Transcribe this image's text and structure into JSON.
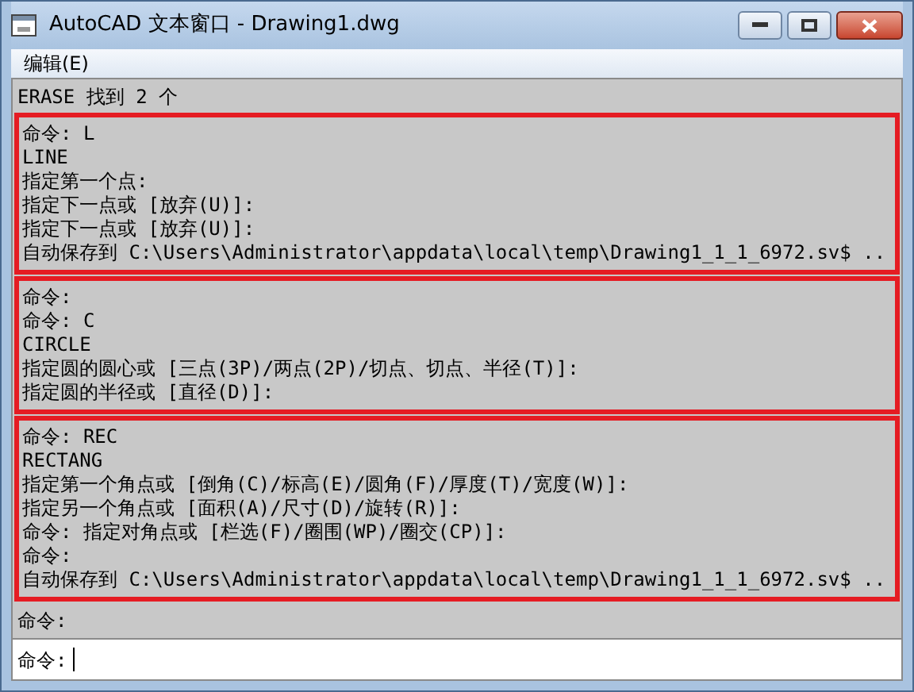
{
  "window": {
    "title": "AutoCAD 文本窗口 - Drawing1.dwg"
  },
  "menu": [
    "编辑(E)"
  ],
  "lines_before": [
    "ERASE 找到 2 个"
  ],
  "highlighted_groups": [
    {
      "lines": [
        "命令: L",
        "LINE",
        "指定第一个点:",
        "指定下一点或 [放弃(U)]:",
        "指定下一点或 [放弃(U)]:",
        "自动保存到 C:\\Users\\Administrator\\appdata\\local\\temp\\Drawing1_1_1_6972.sv$ .."
      ]
    },
    {
      "lines": [
        "命令:",
        "命令: C",
        "CIRCLE",
        "指定圆的圆心或 [三点(3P)/两点(2P)/切点、切点、半径(T)]:",
        "指定圆的半径或 [直径(D)]:"
      ]
    },
    {
      "lines": [
        "命令: REC",
        "RECTANG",
        "指定第一个角点或 [倒角(C)/标高(E)/圆角(F)/厚度(T)/宽度(W)]:",
        "指定另一个角点或 [面积(A)/尺寸(D)/旋转(R)]:",
        "命令: 指定对角点或 [栏选(F)/圈围(WP)/圈交(CP)]:",
        "命令:",
        "自动保存到 C:\\Users\\Administrator\\appdata\\local\\temp\\Drawing1_1_1_6972.sv$ .."
      ]
    }
  ],
  "lines_after": [
    "命令:"
  ],
  "command_input": {
    "prompt": "命令:"
  }
}
